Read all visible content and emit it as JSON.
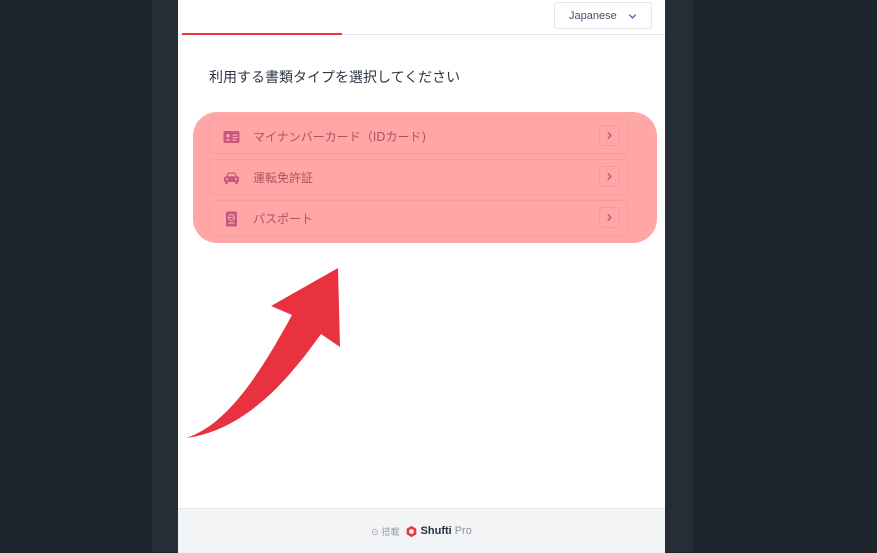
{
  "header": {
    "language": "Japanese"
  },
  "main": {
    "title": "利用する書類タイプを選択してください",
    "options": [
      {
        "label": "マイナンバーカード（IDカード)",
        "icon": "id-card-icon"
      },
      {
        "label": "運転免許証",
        "icon": "car-icon"
      },
      {
        "label": "パスポート",
        "icon": "passport-icon"
      }
    ]
  },
  "footer": {
    "powered_by": "⊙ 搭載",
    "brand_name": "Shufti",
    "brand_sub": "Pro"
  },
  "colors": {
    "accent": "#e5383b",
    "icon": "#8a5fa8",
    "highlight": "#ff5555",
    "annotation_arrow": "#e8323f"
  }
}
